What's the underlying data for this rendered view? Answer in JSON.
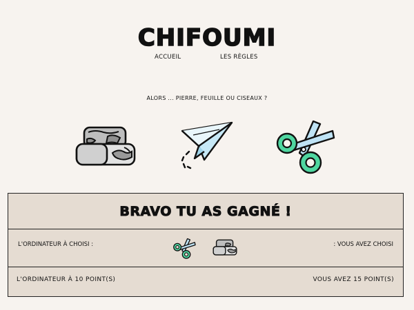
{
  "header": {
    "title": "CHIFOUMI",
    "nav": [
      {
        "label": "ACCUEIL"
      },
      {
        "label": "LES RÈGLES"
      }
    ]
  },
  "game": {
    "prompt": "ALORS ... PIERRE, FEUILLE OU CISEAUX ?",
    "choices": [
      {
        "name": "pierre",
        "icon": "rock-icon"
      },
      {
        "name": "feuille",
        "icon": "paper-plane-icon"
      },
      {
        "name": "ciseaux",
        "icon": "scissors-icon"
      }
    ]
  },
  "result": {
    "message": "BRAVO TU AS GAGNÉ !",
    "computer_label": "L'ORDINATEUR À CHOISI :",
    "user_label": ": VOUS AVEZ CHOISI",
    "computer_choice": "scissors-icon",
    "user_choice": "rock-icon",
    "computer_score": "L'ORDINATEUR À 10 POINT(S)",
    "user_score": "VOUS AVEZ 15 POINT(S)"
  },
  "colors": {
    "background": "#f7f3ef",
    "panel": "#e5dcd2",
    "scissors_green": "#4fd6a0",
    "scissors_blue": "#bfe3f5",
    "paper_blue": "#bfe6f7",
    "rock_gray": "#b9b9b9"
  }
}
